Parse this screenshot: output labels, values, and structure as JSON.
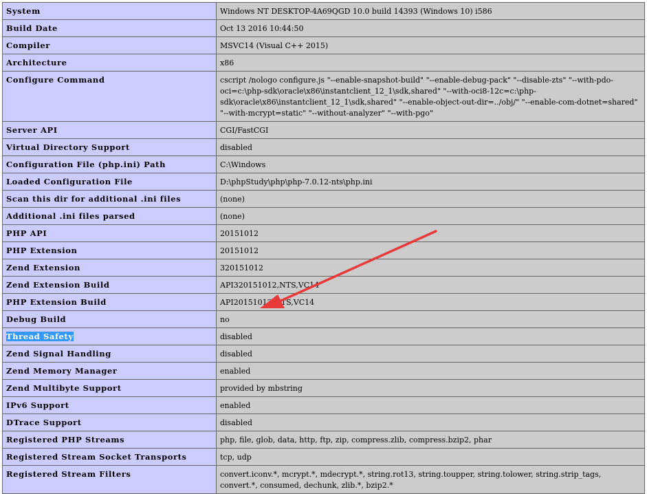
{
  "rows": [
    {
      "key": "System",
      "value": "Windows NT DESKTOP-4A69QGD 10.0 build 14393 (Windows 10) i586"
    },
    {
      "key": "Build Date",
      "value": "Oct 13 2016 10:44:50"
    },
    {
      "key": "Compiler",
      "value": "MSVC14 (Visual C++ 2015)"
    },
    {
      "key": "Architecture",
      "value": "x86"
    },
    {
      "key": "Configure Command",
      "value": "cscript /nologo configure.js \"--enable-snapshot-build\" \"--enable-debug-pack\" \"--disable-zts\" \"--with-pdo-oci=c:\\php-sdk\\oracle\\x86\\instantclient_12_1\\sdk,shared\" \"--with-oci8-12c=c:\\php-sdk\\oracle\\x86\\instantclient_12_1\\sdk,shared\" \"--enable-object-out-dir=../obj/\" \"--enable-com-dotnet=shared\" \"--with-mcrypt=static\" \"--without-analyzer\" \"--with-pgo\""
    },
    {
      "key": "Server API",
      "value": "CGI/FastCGI"
    },
    {
      "key": "Virtual Directory Support",
      "value": "disabled"
    },
    {
      "key": "Configuration File (php.ini) Path",
      "value": "C:\\Windows"
    },
    {
      "key": "Loaded Configuration File",
      "value": "D:\\phpStudy\\php\\php-7.0.12-nts\\php.ini"
    },
    {
      "key": "Scan this dir for additional .ini files",
      "value": "(none)"
    },
    {
      "key": "Additional .ini files parsed",
      "value": "(none)"
    },
    {
      "key": "PHP API",
      "value": "20151012"
    },
    {
      "key": "PHP Extension",
      "value": "20151012"
    },
    {
      "key": "Zend Extension",
      "value": "320151012"
    },
    {
      "key": "Zend Extension Build",
      "value": "API320151012,NTS,VC14"
    },
    {
      "key": "PHP Extension Build",
      "value": "API20151012,NTS,VC14"
    },
    {
      "key": "Debug Build",
      "value": "no"
    },
    {
      "key": "Thread Safety",
      "value": "disabled"
    },
    {
      "key": "Zend Signal Handling",
      "value": "disabled"
    },
    {
      "key": "Zend Memory Manager",
      "value": "enabled"
    },
    {
      "key": "Zend Multibyte Support",
      "value": "provided by mbstring"
    },
    {
      "key": "IPv6 Support",
      "value": "enabled"
    },
    {
      "key": "DTrace Support",
      "value": "disabled"
    },
    {
      "key": "Registered PHP Streams",
      "value": "php, file, glob, data, http, ftp, zip, compress.zlib, compress.bzip2, phar"
    },
    {
      "key": "Registered Stream Socket Transports",
      "value": "tcp, udp"
    },
    {
      "key": "Registered Stream Filters",
      "value": "convert.iconv.*, mcrypt.*, mdecrypt.*, string.rot13, string.toupper, string.tolower, string.strip_tags, convert.*, consumed, dechunk, zlib.*, bzip2.*"
    }
  ],
  "highlighted_row": "Thread Safety",
  "colors": {
    "key_cell_bg": "#ccccff",
    "value_cell_bg": "#cccccc",
    "border": "#666666",
    "selection_bg": "#3399ff",
    "arrow": "#e83a3a"
  }
}
